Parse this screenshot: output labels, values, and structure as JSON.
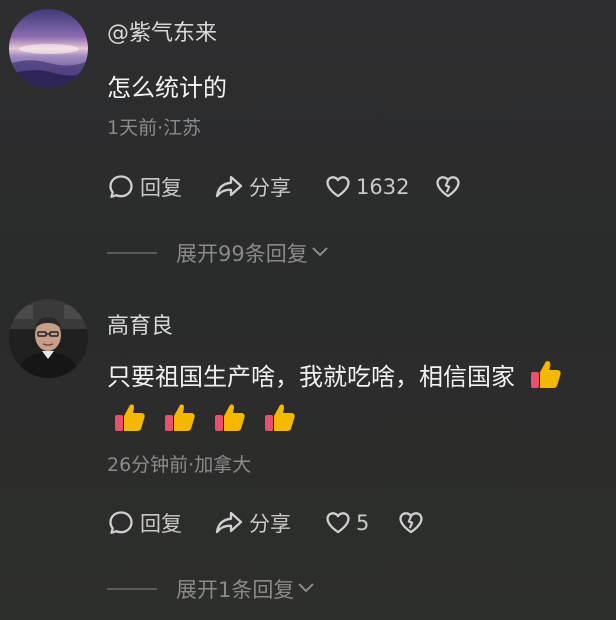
{
  "comments": [
    {
      "username": "@紫气东来",
      "text": "怎么统计的",
      "meta": "1天前·江苏",
      "reply_label": "回复",
      "share_label": "分享",
      "likes": "1632",
      "expand_label": "展开99条回复"
    },
    {
      "username": "高育良",
      "text": "只要祖国生产啥，我就吃啥，相信国家",
      "meta": "26分钟前·加拿大",
      "reply_label": "回复",
      "share_label": "分享",
      "likes": "5",
      "expand_label": "展开1条回复"
    }
  ],
  "icons": {
    "reply": "comment-bubble-icon",
    "share": "share-arrow-icon",
    "like": "heart-icon",
    "dislike": "broken-heart-icon",
    "expand": "chevron-down-icon",
    "emoji": "thumbs-up-emoji"
  }
}
